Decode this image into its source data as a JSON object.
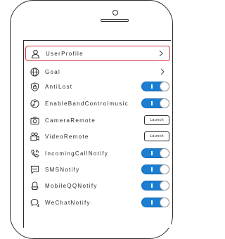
{
  "menu": {
    "items": [
      {
        "label": "UserProfile",
        "icon": "user-icon",
        "control": "chevron"
      },
      {
        "label": "Goal",
        "icon": "globe-icon",
        "control": "chevron"
      },
      {
        "label": "AntiLost",
        "icon": "shield-lock-icon",
        "control": "toggle",
        "on": true
      },
      {
        "label": "EnableBandControlmusic",
        "icon": "music-icon",
        "control": "toggle",
        "on": true
      },
      {
        "label": "CameraRemote",
        "icon": "camera-icon",
        "control": "launch",
        "button": "Launch"
      },
      {
        "label": "VideoRemote",
        "icon": "video-icon",
        "control": "launch",
        "button": "Launch"
      },
      {
        "label": "IncomingCallNotify",
        "icon": "phone-icon",
        "control": "toggle",
        "on": true
      },
      {
        "label": "SMSNotify",
        "icon": "sms-icon",
        "control": "toggle",
        "on": true
      },
      {
        "label": "MobileQQNotify",
        "icon": "qq-icon",
        "control": "toggle",
        "on": true
      },
      {
        "label": "WeChatNotify",
        "icon": "chat-icon",
        "control": "toggle",
        "on": true
      }
    ]
  },
  "colors": {
    "toggle_on": "#1a7fd4",
    "highlight": "#d6343d"
  }
}
